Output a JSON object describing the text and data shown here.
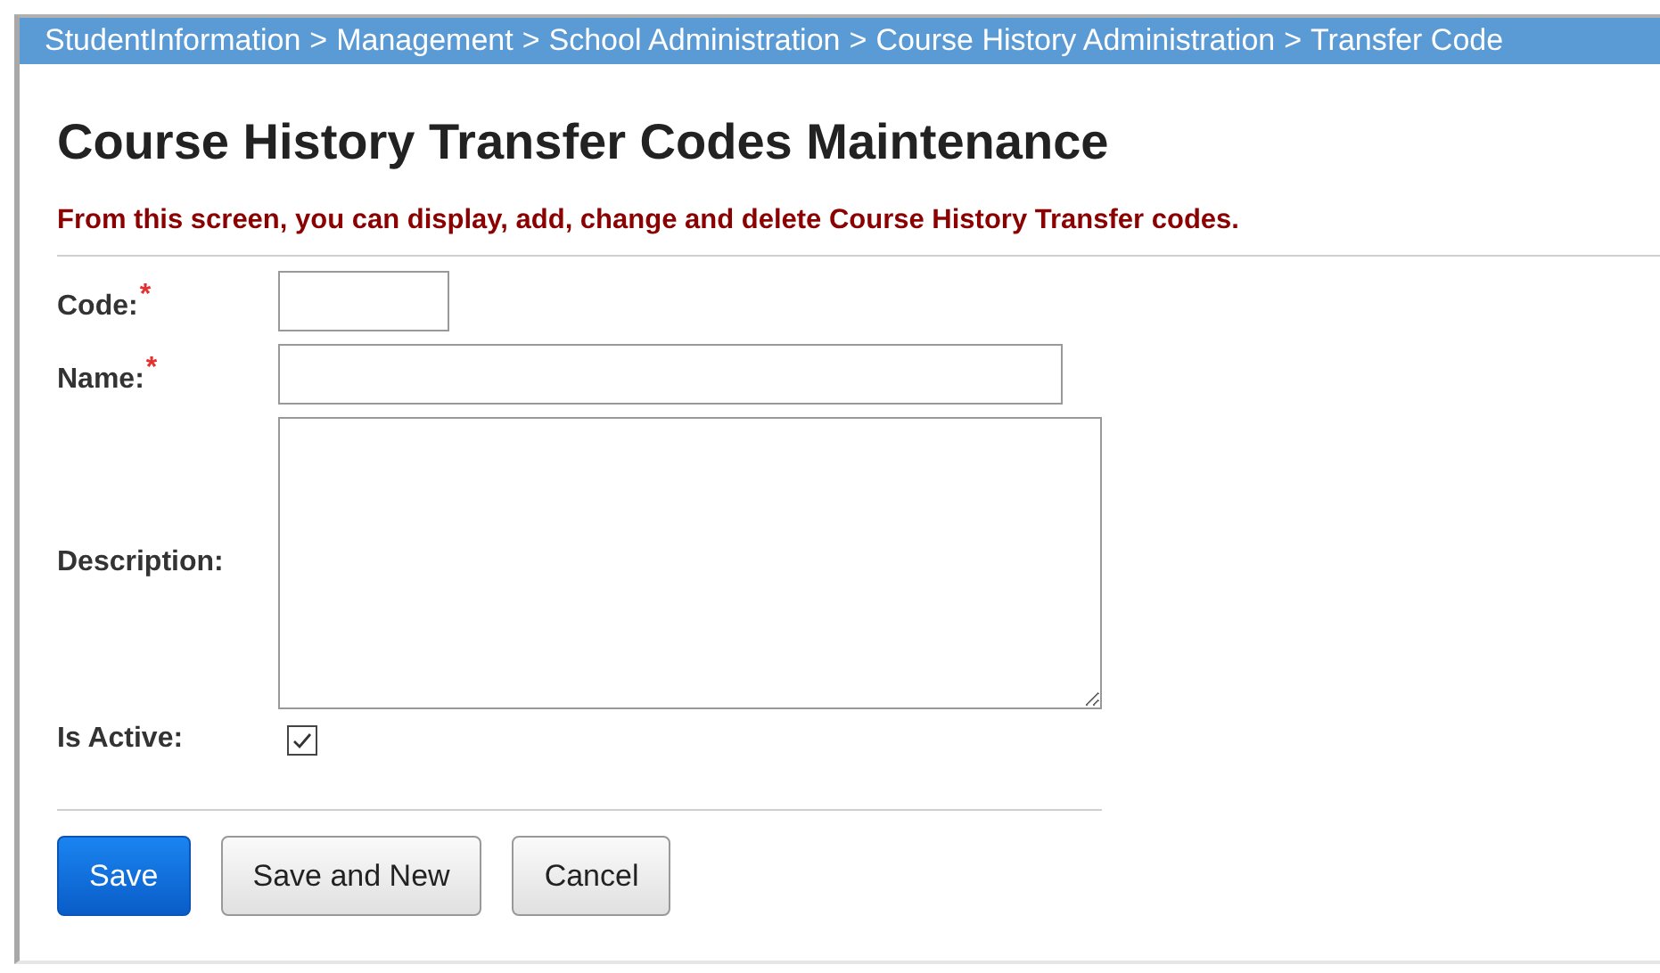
{
  "breadcrumb": {
    "separator": ">",
    "items": [
      "StudentInformation",
      "Management",
      "School Administration",
      "Course History Administration",
      "Transfer Code"
    ]
  },
  "title": "Course History Transfer Codes Maintenance",
  "instructions": "From this screen, you can display, add, change and delete Course History Transfer codes.",
  "fields": [
    {
      "kind": "text",
      "label": "Code:",
      "required_mark": "*",
      "wide": false
    },
    {
      "kind": "text",
      "label": "Name:",
      "required_mark": "*",
      "wide": true
    },
    {
      "kind": "textarea",
      "label": "Description:"
    },
    {
      "kind": "checkbox",
      "label": "Is Active:",
      "checked": true
    }
  ],
  "buttons": [
    {
      "label": "Save",
      "primary": true
    },
    {
      "label": "Save and New",
      "primary": false
    },
    {
      "label": "Cancel",
      "primary": false
    }
  ]
}
